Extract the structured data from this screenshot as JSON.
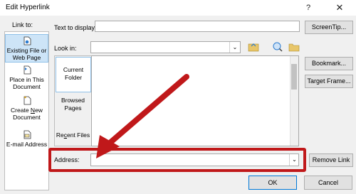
{
  "window": {
    "title": "Edit Hyperlink",
    "help_glyph": "?",
    "close_glyph": "✕"
  },
  "link_to": {
    "label": "Link to:",
    "items": [
      {
        "label_line1": "Existing File or",
        "label_line2": "Web Page",
        "icon": "file-icon",
        "selected": true
      },
      {
        "label_line1": "Place in This",
        "label_line2": "Document",
        "icon": "bookmark-doc-icon",
        "selected": false
      },
      {
        "label_line1": "Create New",
        "label_line2": "Document",
        "icon": "new-doc-icon",
        "selected": false
      },
      {
        "label_line1": "E-mail Address",
        "label_line2": "",
        "icon": "email-icon",
        "selected": false
      }
    ]
  },
  "text_to_display": {
    "label": "Text to display:",
    "value": ""
  },
  "screentip_button": "ScreenTip...",
  "look_in": {
    "label": "Look in:",
    "value": ""
  },
  "browse_tabs": [
    {
      "line1": "Current",
      "line2": "Folder",
      "selected": true
    },
    {
      "line1": "Browsed",
      "line2": "Pages",
      "selected": false
    },
    {
      "line1": "Recent Files",
      "line2": "",
      "selected": false
    }
  ],
  "side_buttons": {
    "bookmark": "Bookmark...",
    "target_frame": "Target Frame...",
    "remove_link": "Remove Link"
  },
  "address": {
    "label": "Address:",
    "value": ""
  },
  "footer": {
    "ok": "OK",
    "cancel": "Cancel"
  },
  "annotation": {
    "color": "#c0181a"
  }
}
